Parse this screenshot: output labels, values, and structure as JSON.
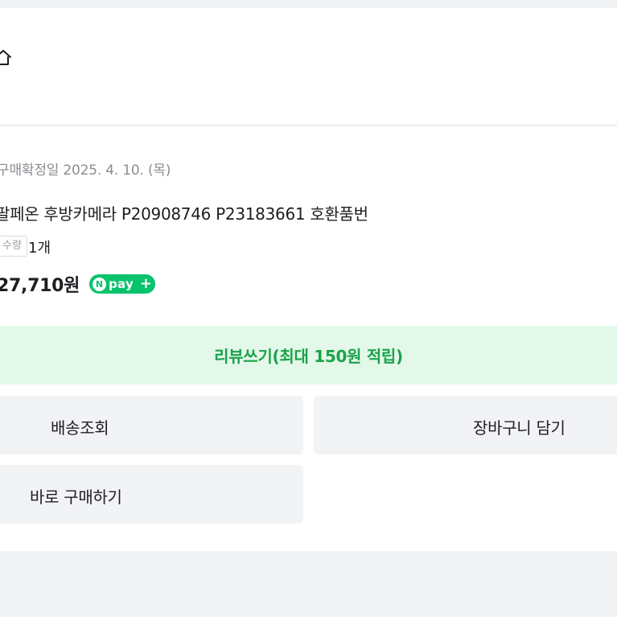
{
  "header": {
    "home_icon": "home-icon"
  },
  "order": {
    "confirm_date": "구매확정일 2025. 4. 10. (목)",
    "product_name": "팔페온 후방카메라 P20908746 P23183661 호환품번",
    "quantity_label": "수량",
    "quantity_value": "1개",
    "price": "27,710원",
    "npay_badge": {
      "logo": "N",
      "text": "pay",
      "plus": "+",
      "color": "#08c36b"
    }
  },
  "actions": {
    "review_label": "리뷰쓰기(최대 150원 적립)",
    "track_label": "배송조회",
    "cart_label": "장바구니 담기",
    "buy_again_label": "바로 구매하기"
  },
  "colors": {
    "accent_green": "#1ba24a",
    "review_bg": "#e3f8e9",
    "button_bg": "#f2f3f5"
  }
}
